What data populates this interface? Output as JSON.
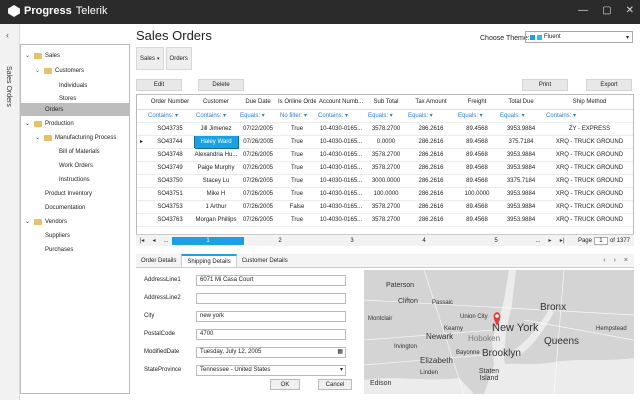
{
  "app": {
    "logo_text": "Progress",
    "logo_sub": "Telerik",
    "window_controls": [
      "minimize-icon",
      "maximize-icon",
      "close-icon"
    ]
  },
  "side_tab": {
    "label": "Sales Orders"
  },
  "header": {
    "title": "Sales Orders",
    "theme_label": "Choose Theme:",
    "theme_value": "Fluent",
    "theme_swatches": [
      "#1ba1e2",
      "#20c0e8"
    ]
  },
  "tree": {
    "items": [
      {
        "label": "Sales",
        "expander": "v",
        "folder": true
      },
      {
        "label": "Customers",
        "expander": "v",
        "folder": true
      },
      {
        "label": "Individuals"
      },
      {
        "label": "Stores"
      },
      {
        "label": "Orders",
        "selected": true
      },
      {
        "label": "Production",
        "expander": "v",
        "folder": true
      },
      {
        "label": "Manufacturing Process",
        "expander": "v",
        "folder": true
      },
      {
        "label": "Bill of Materials"
      },
      {
        "label": "Work Orders"
      },
      {
        "label": "Instructions"
      },
      {
        "label": "Product Inventory"
      },
      {
        "label": "Documentation"
      },
      {
        "label": "Vendors",
        "expander": "v",
        "folder": true
      },
      {
        "label": "Suppliers"
      },
      {
        "label": "Purchases"
      }
    ]
  },
  "group_chips": [
    {
      "label": "Sales",
      "caret": "v"
    },
    {
      "label": "Orders"
    }
  ],
  "toolbar": {
    "edit": "Edit",
    "delete": "Delete",
    "print": "Print",
    "export": "Export"
  },
  "grid": {
    "columns": [
      "Order Number",
      "Customer",
      "Due Date",
      "Is Online Order",
      "Account Numb...",
      "Sub Total",
      "Tax Amount",
      "Freight",
      "Total Due",
      "Ship Method"
    ],
    "filters": [
      "Contains:",
      "Contains:",
      "Equals:",
      "No filter:",
      "Contains:",
      "Equals:",
      "Equals:",
      "Equals:",
      "Equals:",
      "Contains:"
    ],
    "rows": [
      [
        "SO43735",
        "Jill Jimenez",
        "07/22/2005",
        "True",
        "10-4030-0165...",
        "3578.2700",
        "286.2616",
        "89.4568",
        "3953.9884",
        "ZY - EXPRESS"
      ],
      [
        "SO43744",
        "Haley Ward",
        "07/26/2005",
        "True",
        "10-4030-0165...",
        "0.0000",
        "286.2616",
        "89.4568",
        "375.7184",
        "XRQ - TRUCK GROUND"
      ],
      [
        "SO43748",
        "Alexandria Hu...",
        "07/26/2005",
        "True",
        "10-4030-0165...",
        "3578.2700",
        "286.2616",
        "89.4568",
        "3953.9884",
        "XRQ - TRUCK GROUND"
      ],
      [
        "SO43749",
        "Paige Murphy",
        "07/26/2005",
        "True",
        "10-4030-0165...",
        "3578.2700",
        "286.2616",
        "89.4568",
        "3953.9884",
        "XRQ - TRUCK GROUND"
      ],
      [
        "SO43750",
        "Stacey Lu",
        "07/26/2005",
        "True",
        "10-4030-0165...",
        "3000.0000",
        "286.2616",
        "89.4568",
        "3375.7184",
        "XRQ - TRUCK GROUND"
      ],
      [
        "SO43751",
        "Mike H",
        "07/26/2005",
        "True",
        "10-4030-0165...",
        "100.0000",
        "286.2616",
        "100.0000",
        "3953.9884",
        "XRQ - TRUCK GROUND"
      ],
      [
        "SO43753",
        "1 Arthur",
        "07/26/2005",
        "False",
        "10-4030-0165...",
        "3578.2700",
        "286.2616",
        "89.4568",
        "3953.9884",
        "XRQ - TRUCK GROUND"
      ],
      [
        "SO43763",
        "Morgan Phillips",
        "07/26/2005",
        "True",
        "10-4030-0165...",
        "3578.2700",
        "286.2616",
        "89.4568",
        "3953.9884",
        "XRQ - TRUCK GROUND"
      ]
    ],
    "current_row_indicator": "▸"
  },
  "pager": {
    "first": "|◂",
    "prev": "◂",
    "ellipsis_left": "...",
    "pages": [
      "1",
      "2",
      "3",
      "4",
      "5"
    ],
    "ellipsis_right": "...",
    "next": "▸",
    "last": "▸|",
    "page_label": "Page",
    "page_value": "1",
    "page_total": "of 1377"
  },
  "detail_tabs": {
    "tabs": [
      "Order Details",
      "Shipping Details",
      "Customer Details"
    ],
    "prev": "‹",
    "next": "›",
    "close": "×"
  },
  "form": {
    "fields": [
      {
        "label": "AddressLine1",
        "value": "6071 Mi Casa Court"
      },
      {
        "label": "AddressLine2",
        "value": ""
      },
      {
        "label": "City",
        "value": "new york"
      },
      {
        "label": "PostalCode",
        "value": "4700"
      },
      {
        "label": "ModifiedDate",
        "value": "Tuesday, July 12, 2005",
        "icon": "calendar-icon"
      },
      {
        "label": "StateProvince",
        "value": "Tennessee - United States",
        "icon": "chevron-down-icon"
      }
    ],
    "ok": "OK",
    "cancel": "Cancel"
  },
  "map": {
    "labels": [
      "Bronx",
      "New York",
      "Hoboken",
      "Brooklyn",
      "Queens",
      "Newark",
      "Elizabeth",
      "Staten Island",
      "Hempstead",
      "Paterson",
      "Clifton",
      "Passaic",
      "Union City",
      "Montclair",
      "Edison",
      "Linden",
      "Bayonne",
      "Irvington",
      "Kearny"
    ],
    "pin_color": "#e53935",
    "land_color": "#d4d4d4",
    "water_color": "#ececec"
  }
}
